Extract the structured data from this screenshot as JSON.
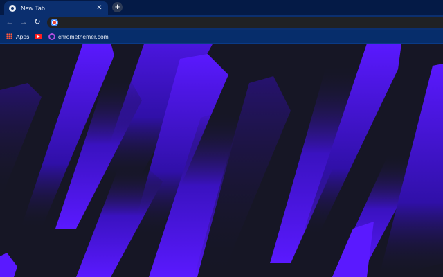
{
  "tab": {
    "title": "New Tab",
    "close_glyph": "✕"
  },
  "new_tab_glyph": "+",
  "toolbar": {
    "back_glyph": "←",
    "forward_glyph": "→",
    "reload_glyph": "↻",
    "address_value": ""
  },
  "bookmarks": {
    "apps_label": "Apps",
    "site_label": "chromethemer.com"
  },
  "colors": {
    "frame": "#041a46",
    "toolbar": "#0b2f6f",
    "background": "#161625",
    "accent_purple": "#5a19ff"
  }
}
